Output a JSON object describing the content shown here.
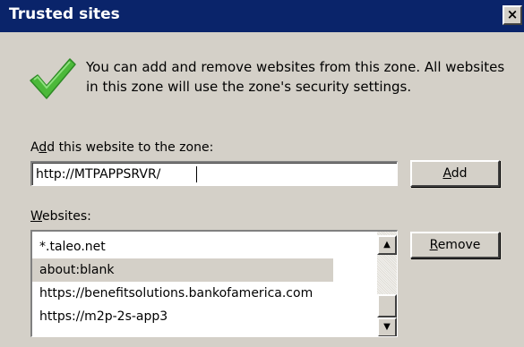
{
  "window": {
    "title": "Trusted sites",
    "close_glyph": "×"
  },
  "intro": {
    "text": "You can add and remove websites from this zone. All websites in this zone will use the zone's security settings.",
    "icon": "green-checkmark-icon"
  },
  "add_section": {
    "label_prefix": "A",
    "label_mnemonic": "d",
    "label_rest": "d this website to the zone:",
    "input_value": "http://MTPAPPSRVR/",
    "add_button": {
      "mnemonic": "A",
      "rest": "dd"
    }
  },
  "websites_section": {
    "label_mnemonic": "W",
    "label_rest": "ebsites:",
    "items": [
      {
        "text": "*.taleo.net"
      },
      {
        "text": "about:blank"
      },
      {
        "text": "https://benefitsolutions.bankofamerica.com"
      },
      {
        "text": "https://m2p-2s-app3"
      }
    ],
    "remove_button": {
      "mnemonic": "R",
      "rest": "emove"
    }
  },
  "scrollbar": {
    "up_glyph": "▲",
    "down_glyph": "▼"
  },
  "colors": {
    "titlebar": "#0a246a",
    "dialog_bg": "#d4d0c8",
    "check_green": "#4cb93a"
  }
}
